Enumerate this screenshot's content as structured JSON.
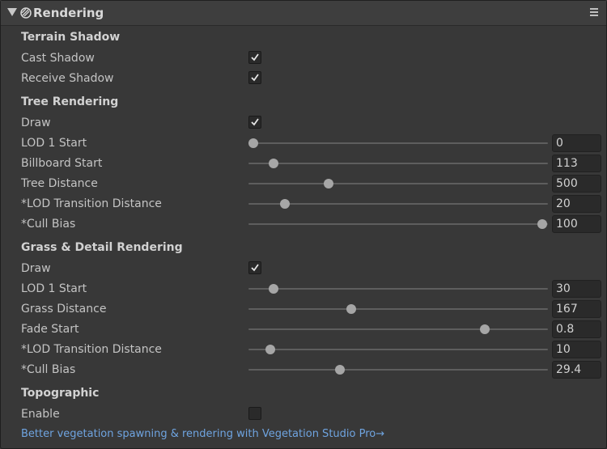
{
  "header": {
    "title": "Rendering"
  },
  "terrain_shadow": {
    "title": "Terrain Shadow",
    "cast_shadow": {
      "label": "Cast Shadow",
      "checked": true
    },
    "receive_shadow": {
      "label": "Receive Shadow",
      "checked": true
    }
  },
  "tree_rendering": {
    "title": "Tree Rendering",
    "draw": {
      "label": "Draw",
      "checked": true
    },
    "sliders": [
      {
        "label": "LOD 1 Start",
        "value": "0",
        "fraction": 0.0
      },
      {
        "label": "Billboard Start",
        "value": "113",
        "fraction": 0.07
      },
      {
        "label": "Tree Distance",
        "value": "500",
        "fraction": 0.26
      },
      {
        "label": "*LOD Transition Distance",
        "value": "20",
        "fraction": 0.11
      },
      {
        "label": "*Cull Bias",
        "value": "100",
        "fraction": 1.0
      }
    ]
  },
  "grass_rendering": {
    "title": "Grass & Detail Rendering",
    "draw": {
      "label": "Draw",
      "checked": true
    },
    "sliders": [
      {
        "label": "LOD 1 Start",
        "value": "30",
        "fraction": 0.07
      },
      {
        "label": "Grass Distance",
        "value": "167",
        "fraction": 0.34
      },
      {
        "label": "Fade Start",
        "value": "0.8",
        "fraction": 0.8
      },
      {
        "label": "*LOD Transition Distance",
        "value": "10",
        "fraction": 0.06
      },
      {
        "label": "*Cull Bias",
        "value": "29.4",
        "fraction": 0.3
      }
    ]
  },
  "topographic": {
    "title": "Topographic",
    "enable": {
      "label": "Enable",
      "checked": false
    }
  },
  "promo_link": "Better vegetation spawning & rendering with Vegetation Studio Pro→",
  "icons": {
    "foldout": "triangle-down-icon",
    "component": "rendering-component-icon",
    "menu": "hamburger-menu-icon",
    "check": "checkmark-icon"
  },
  "colors": {
    "background": "#383838",
    "header": "#3e3e3e",
    "field": "#2a2a2a",
    "knob": "#a6a6a6",
    "link": "#6fa4e0"
  }
}
